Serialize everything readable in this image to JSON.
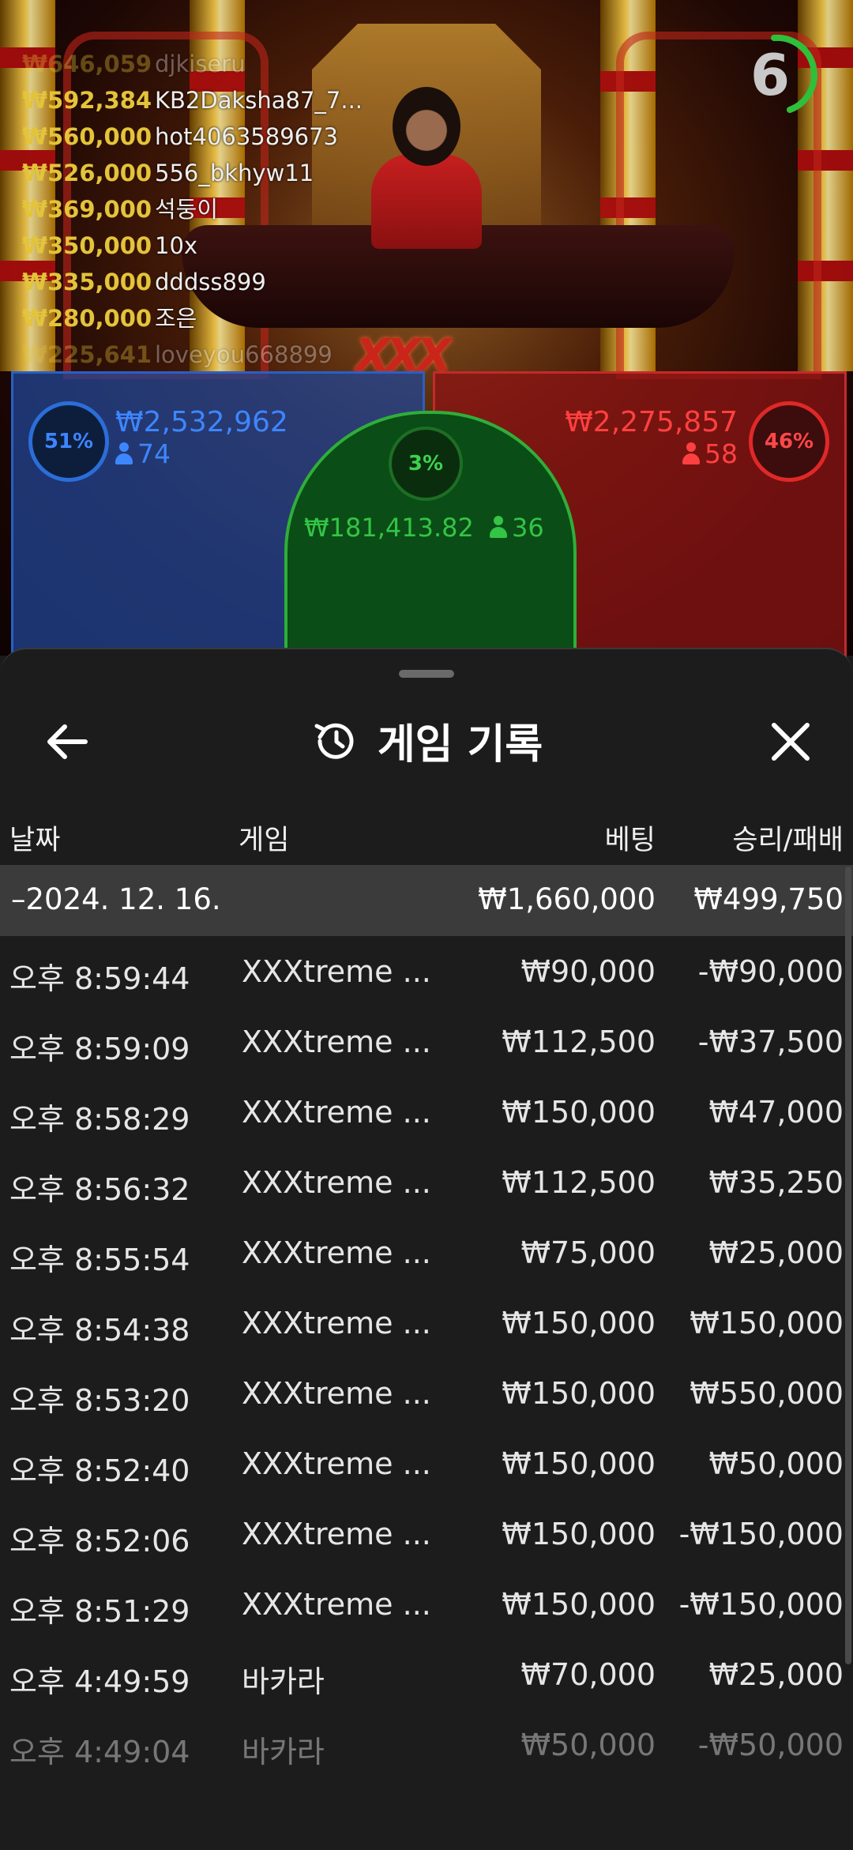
{
  "live": {
    "timer": "6",
    "leaderboard": [
      {
        "amount": "₩646,059",
        "name": "djkiseru"
      },
      {
        "amount": "₩592,384",
        "name": "KB2Daksha87_7..."
      },
      {
        "amount": "₩560,000",
        "name": "hot4063589673"
      },
      {
        "amount": "₩526,000",
        "name": "556_bkhyw11"
      },
      {
        "amount": "₩369,000",
        "name": "석둥이"
      },
      {
        "amount": "₩350,000",
        "name": "10x"
      },
      {
        "amount": "₩335,000",
        "name": "dddss899"
      },
      {
        "amount": "₩280,000",
        "name": "조은"
      },
      {
        "amount": "₩225,641",
        "name": "loveyou668899"
      }
    ],
    "logo_text": "XXX",
    "player": {
      "percent": "51%",
      "amount": "₩2,532,962",
      "count": "74"
    },
    "banker": {
      "percent": "46%",
      "amount": "₩2,275,857",
      "count": "58"
    },
    "tie": {
      "percent": "3%",
      "amount": "₩181,413.82",
      "count": "36"
    }
  },
  "sheet": {
    "title": "게임 기록",
    "columns": {
      "date": "날짜",
      "game": "게임",
      "bet": "베팅",
      "win": "승리/패배"
    },
    "date_group": {
      "date": "–2024. 12. 16.",
      "bet": "₩1,660,000",
      "win": "₩499,750"
    },
    "rows": [
      {
        "time": "오후 8:59:44",
        "game": "XXXtreme ...",
        "bet": "₩90,000",
        "win": "-₩90,000"
      },
      {
        "time": "오후 8:59:09",
        "game": "XXXtreme ...",
        "bet": "₩112,500",
        "win": "-₩37,500"
      },
      {
        "time": "오후 8:58:29",
        "game": "XXXtreme ...",
        "bet": "₩150,000",
        "win": "₩47,000"
      },
      {
        "time": "오후 8:56:32",
        "game": "XXXtreme ...",
        "bet": "₩112,500",
        "win": "₩35,250"
      },
      {
        "time": "오후 8:55:54",
        "game": "XXXtreme ...",
        "bet": "₩75,000",
        "win": "₩25,000"
      },
      {
        "time": "오후 8:54:38",
        "game": "XXXtreme ...",
        "bet": "₩150,000",
        "win": "₩150,000"
      },
      {
        "time": "오후 8:53:20",
        "game": "XXXtreme ...",
        "bet": "₩150,000",
        "win": "₩550,000"
      },
      {
        "time": "오후 8:52:40",
        "game": "XXXtreme ...",
        "bet": "₩150,000",
        "win": "₩50,000"
      },
      {
        "time": "오후 8:52:06",
        "game": "XXXtreme ...",
        "bet": "₩150,000",
        "win": "-₩150,000"
      },
      {
        "time": "오후 8:51:29",
        "game": "XXXtreme ...",
        "bet": "₩150,000",
        "win": "-₩150,000"
      },
      {
        "time": "오후 4:49:59",
        "game": "바카라",
        "bet": "₩70,000",
        "win": "₩25,000"
      },
      {
        "time": "오후 4:49:04",
        "game": "바카라",
        "bet": "₩50,000",
        "win": "-₩50,000"
      }
    ]
  },
  "icons": {
    "back": "arrow-left-icon",
    "history": "history-icon",
    "close": "close-icon",
    "user": "person-icon"
  },
  "colors": {
    "player": "#3d86ff",
    "banker": "#ff4040",
    "tie": "#34c446",
    "gold": "#e3c43a",
    "timer_ring": "#2fbf3a"
  }
}
